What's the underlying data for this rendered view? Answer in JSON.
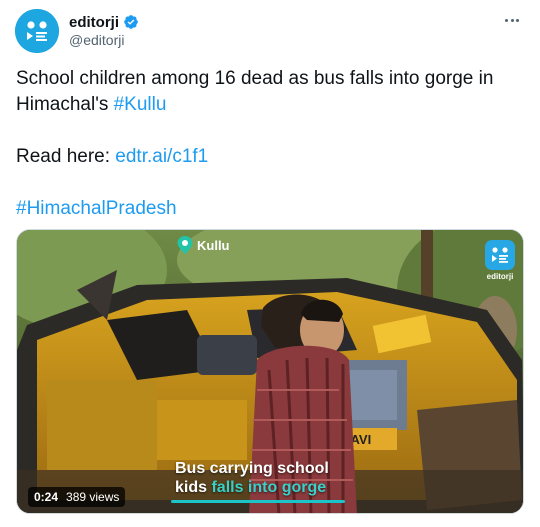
{
  "author": {
    "display_name": "editorji",
    "handle": "@editorji",
    "verified": true,
    "avatar_icon": "editorji-logo-icon",
    "brand_color": "#1da6e0"
  },
  "tweet": {
    "line1_text": "School children among 16 dead as bus falls into gorge in Himachal's ",
    "line1_hashtag": "#Kullu",
    "read_label": "Read here: ",
    "read_link": "edtr.ai/c1f1",
    "hashtag2": "#HimachalPradesh",
    "link_color": "#1d9bf0"
  },
  "media": {
    "location_label": "Kullu",
    "location_icon": "location-pin-icon",
    "watermark_label": "editorji",
    "caption_line1": "Bus carrying school",
    "caption_line2_plain": "kids ",
    "caption_line2_highlight": "falls into gorge",
    "duration": "0:24",
    "views": "389 views"
  },
  "menu_icon": "more-options-icon"
}
